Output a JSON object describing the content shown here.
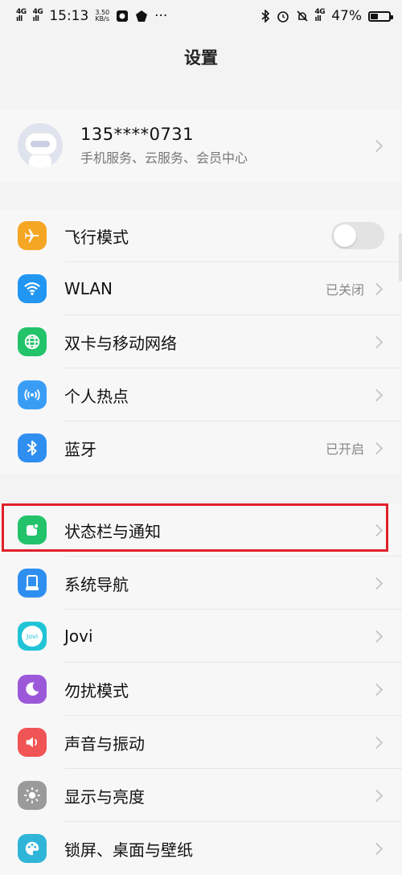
{
  "status_bar": {
    "sig1_a": "4G",
    "sig1_b": "ıll",
    "sig2_a": "4G",
    "sig2_b": "ıll",
    "time": "15:13",
    "speed_value": "3.50",
    "speed_unit": "KB/s",
    "more": "···",
    "carrier2": "4G",
    "battery_percent": "47%",
    "battery_level": 0.47
  },
  "header": {
    "title": "设置"
  },
  "account": {
    "phone": "135****0731",
    "subtitle": "手机服务、云服务、会员中心"
  },
  "network": [
    {
      "label": "飞行模式",
      "icon": "airplane-icon",
      "color": "#f5a623",
      "toggle": false
    },
    {
      "label": "WLAN",
      "icon": "wifi-icon",
      "color": "#2196f3",
      "value": "已关闭"
    },
    {
      "label": "双卡与移动网络",
      "icon": "globe-icon",
      "color": "#22c36a"
    },
    {
      "label": "个人热点",
      "icon": "hotspot-icon",
      "color": "#3a9df5"
    },
    {
      "label": "蓝牙",
      "icon": "bluetooth-icon",
      "color": "#2f8ff0",
      "value": "已开启"
    }
  ],
  "system": [
    {
      "label": "状态栏与通知",
      "icon": "notification-icon",
      "color": "#22c36a"
    },
    {
      "label": "系统导航",
      "icon": "navigation-icon",
      "color": "#2f8ff0"
    },
    {
      "label": "Jovi",
      "icon": "jovi-icon",
      "color": "#21c4d6",
      "icon_text": "Jovi"
    },
    {
      "label": "勿扰模式",
      "icon": "moon-icon",
      "color": "#9b59d9"
    },
    {
      "label": "声音与振动",
      "icon": "speaker-icon",
      "color": "#f05454"
    },
    {
      "label": "显示与亮度",
      "icon": "brightness-icon",
      "color": "#9a9a9a"
    },
    {
      "label": "锁屏、桌面与壁纸",
      "icon": "palette-icon",
      "color": "#2fb5d8"
    }
  ]
}
